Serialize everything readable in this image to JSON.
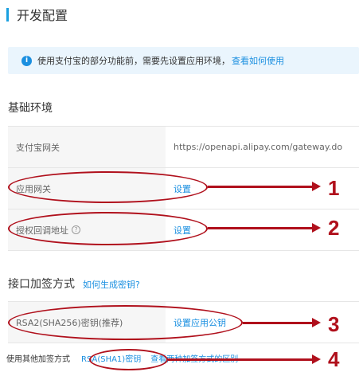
{
  "page_title": "开发配置",
  "notice": {
    "icon": "info-icon",
    "text": "使用支付宝的部分功能前，需要先设置应用环境，",
    "link": "查看如何使用"
  },
  "basic_env": {
    "title": "基础环境",
    "rows": [
      {
        "label": "支付宝网关",
        "value": "https://openapi.alipay.com/gateway.do"
      },
      {
        "label": "应用网关",
        "value": "设置"
      },
      {
        "label": "授权回调地址",
        "value": "设置"
      }
    ]
  },
  "signing": {
    "title": "接口加签方式",
    "link": "如何生成密钥?",
    "rows": [
      {
        "label": "RSA2(SHA256)密钥(推荐)",
        "value": "设置应用公钥"
      }
    ],
    "other_label": "使用其他加签方式",
    "other_link": "RSA(SHA1)密钥",
    "diff_link": "查看两种加签方式的区别"
  },
  "annotations": [
    "1",
    "2",
    "3",
    "4"
  ],
  "colors": {
    "accent": "#1a8fe0",
    "annotation": "#b0101c",
    "title_bar": "#1aa0e0"
  }
}
